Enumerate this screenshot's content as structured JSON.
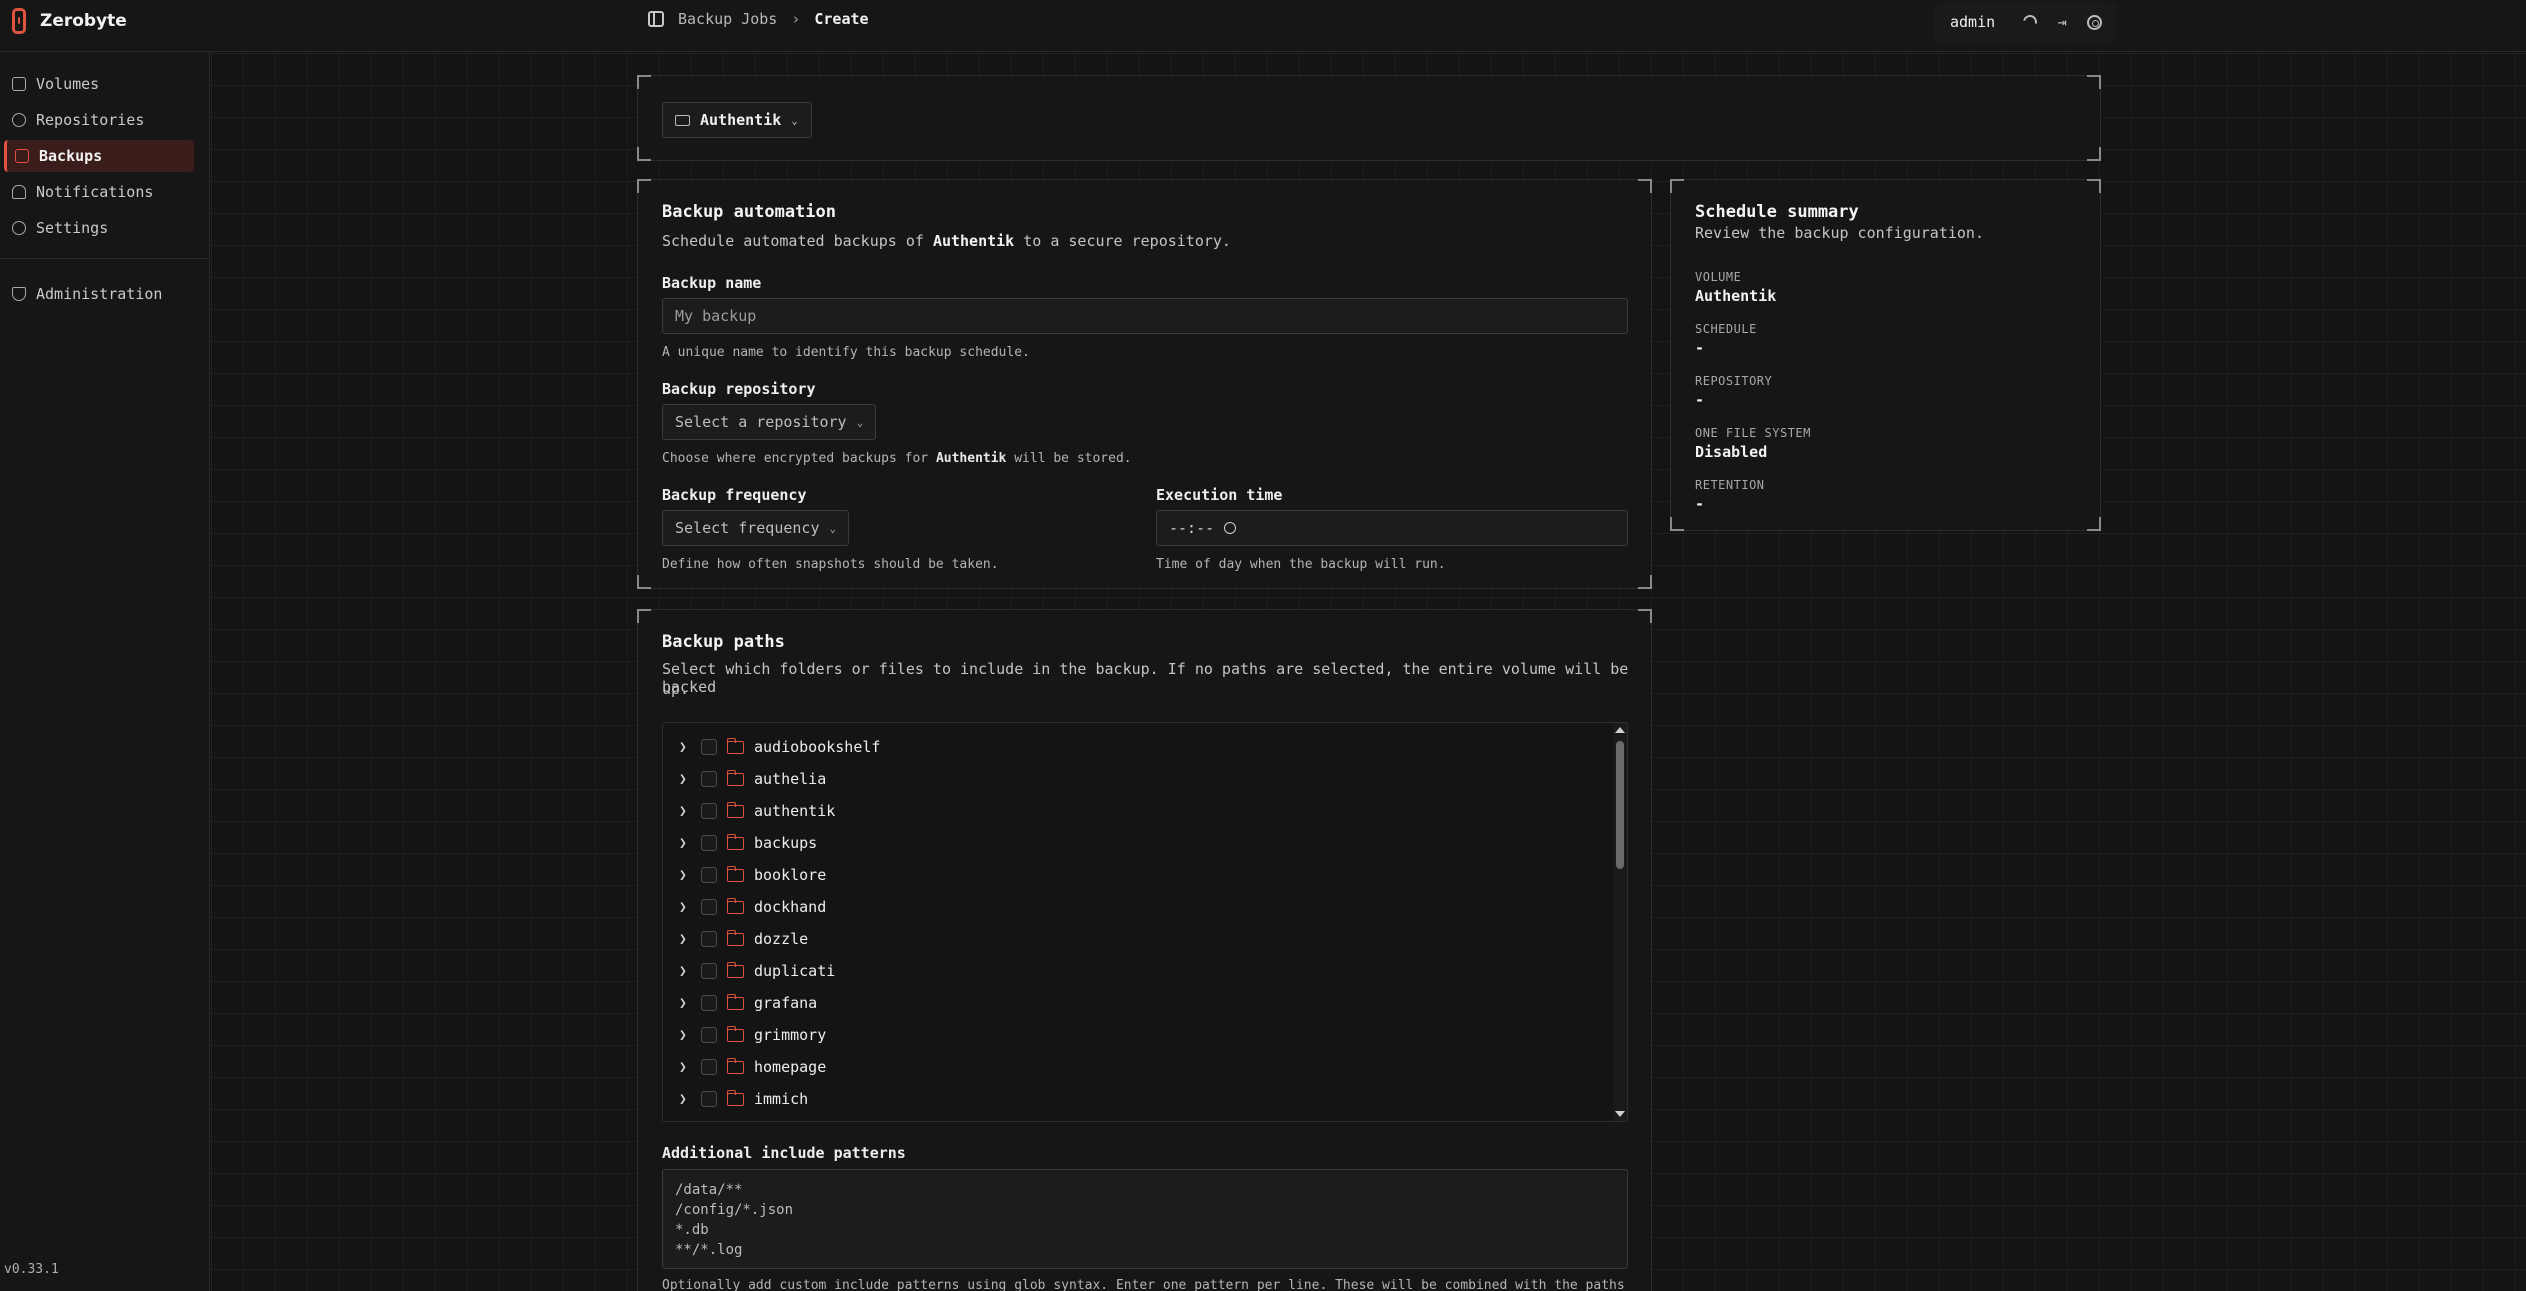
{
  "app": {
    "name": "Zerobyte",
    "version": "v0.33.1"
  },
  "breadcrumb": {
    "parent": "Backup Jobs",
    "current": "Create"
  },
  "user": {
    "name": "admin"
  },
  "sidebar": {
    "items": [
      {
        "label": "Volumes",
        "icon": "hard-drive-icon"
      },
      {
        "label": "Repositories",
        "icon": "database-icon"
      },
      {
        "label": "Backups",
        "icon": "calendar-icon",
        "active": true
      },
      {
        "label": "Notifications",
        "icon": "bell-icon"
      },
      {
        "label": "Settings",
        "icon": "gear-icon"
      }
    ],
    "admin_item": {
      "label": "Administration",
      "icon": "shield-icon"
    }
  },
  "volume_select": {
    "value": "Authentik"
  },
  "automation": {
    "title": "Backup automation",
    "desc_prefix": "Schedule automated backups of ",
    "desc_volume": "Authentik",
    "desc_suffix": " to a secure repository.",
    "name_label": "Backup name",
    "name_placeholder": "My backup",
    "name_help": "A unique name to identify this backup schedule.",
    "repo_label": "Backup repository",
    "repo_placeholder": "Select a repository",
    "repo_help_prefix": "Choose where encrypted backups for ",
    "repo_help_volume": "Authentik",
    "repo_help_suffix": " will be stored.",
    "freq_label": "Backup frequency",
    "freq_placeholder": "Select frequency",
    "freq_help": "Define how often snapshots should be taken.",
    "time_label": "Execution time",
    "time_value": "--:--",
    "time_help": "Time of day when the backup will run."
  },
  "summary": {
    "title": "Schedule summary",
    "desc": "Review the backup configuration.",
    "volume_key": "VOLUME",
    "volume_val": "Authentik",
    "schedule_key": "SCHEDULE",
    "schedule_val": "-",
    "repo_key": "REPOSITORY",
    "repo_val": "-",
    "fs_key": "ONE FILE SYSTEM",
    "fs_val": "Disabled",
    "retention_key": "RETENTION",
    "retention_val": "-"
  },
  "paths": {
    "title": "Backup paths",
    "desc_line1": "Select which folders or files to include in the backup. If no paths are selected, the entire volume will be backed",
    "desc_line2": "up.",
    "folders": [
      "audiobookshelf",
      "authelia",
      "authentik",
      "backups",
      "booklore",
      "dockhand",
      "dozzle",
      "duplicati",
      "grafana",
      "grimmory",
      "homepage",
      "immich"
    ],
    "include_label": "Additional include patterns",
    "include_value": "/data/**\n/config/*.json\n*.db\n**/*.log",
    "include_help": "Optionally add custom include patterns using glob syntax. Enter one pattern per line. These will be combined with the paths selected"
  }
}
